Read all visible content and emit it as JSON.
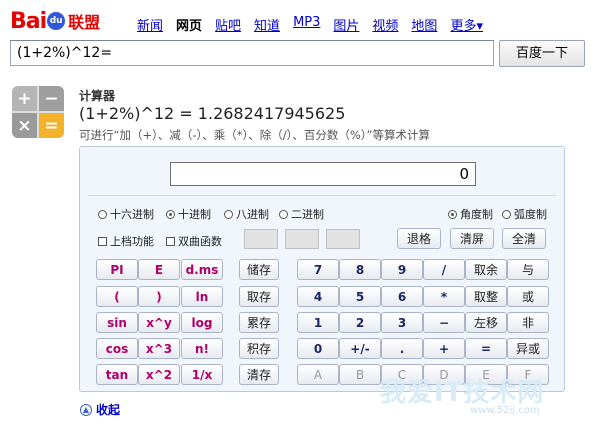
{
  "logo": {
    "bai": "Bai",
    "du": "du",
    "lianmeng": "联盟"
  },
  "nav": [
    {
      "label": "新闻"
    },
    {
      "label": "网页",
      "active": true
    },
    {
      "label": "贴吧"
    },
    {
      "label": "知道"
    },
    {
      "label": "MP3"
    },
    {
      "label": "图片"
    },
    {
      "label": "视频"
    },
    {
      "label": "地图"
    },
    {
      "label": "更多▾"
    }
  ],
  "search": {
    "value": "(1+2%)^12=",
    "button": "百度一下"
  },
  "calculator": {
    "icon_glyphs": [
      "+",
      "−",
      "×",
      "="
    ],
    "title": "计算器",
    "result_line": "(1+2%)^12 = 1.2682417945625",
    "hint": "可进行“加（+）、减（-）、乘（*）、除（/）、百分数（%）”等算术计算",
    "display_value": "0",
    "base_modes": [
      "十六进制",
      "十进制",
      "八进制",
      "二进制"
    ],
    "base_selected": "十进制",
    "angle_modes": [
      "角度制",
      "弧度制"
    ],
    "angle_selected": "角度制",
    "checkboxes": [
      "上档功能",
      "双曲函数"
    ],
    "clear_buttons": [
      "退格",
      "清屏",
      "全清"
    ],
    "func_rows": [
      [
        "PI",
        "E",
        "d.ms"
      ],
      [
        "(",
        ")",
        "ln"
      ],
      [
        "sin",
        "x^y",
        "log"
      ],
      [
        "cos",
        "x^3",
        "n!"
      ],
      [
        "tan",
        "x^2",
        "1/x"
      ]
    ],
    "memory_buttons": [
      "储存",
      "取存",
      "累存",
      "积存",
      "清存"
    ],
    "num_rows": [
      [
        "7",
        "8",
        "9",
        "/"
      ],
      [
        "4",
        "5",
        "6",
        "*"
      ],
      [
        "1",
        "2",
        "3",
        "−"
      ],
      [
        "0",
        "+/-",
        ".",
        "+"
      ]
    ],
    "eq_label": "=",
    "hex_letters": [
      "A",
      "B",
      "C",
      "D",
      "E",
      "F"
    ],
    "op_rows": [
      [
        "取余",
        "与"
      ],
      [
        "取整",
        "或"
      ],
      [
        "左移",
        "非"
      ],
      [
        "=",
        "异或"
      ]
    ],
    "collapse": "收起"
  },
  "watermark": {
    "text": "我爱IT技术网",
    "url": "www.52ij.com"
  }
}
